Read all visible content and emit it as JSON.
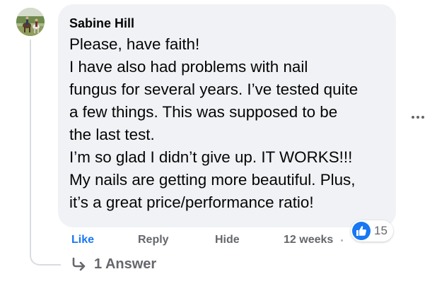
{
  "comment": {
    "author": "Sabine Hill",
    "lines": [
      "Please, have faith!",
      "I have also had problems with nail",
      "fungus for several years. I’ve tested quite",
      "a few things. This was supposed to be",
      "the last test.",
      "I’m so glad I didn’t give up. IT WORKS!!!",
      "My nails are getting more beautiful. Plus,",
      "it’s a great price/performance ratio!"
    ]
  },
  "actions": {
    "like": "Like",
    "reply": "Reply",
    "hide": "Hide",
    "time": "12 weeks"
  },
  "reactions": {
    "icon": "thumbs-up-icon",
    "count": "15"
  },
  "replies": {
    "icon": "reply-arrow-icon",
    "label": "1 Answer"
  },
  "icons": {
    "avatar": "avatar",
    "more": "more-options-icon"
  },
  "colors": {
    "bubble": "#f0f2f5",
    "like_blue": "#1877f2",
    "secondary_text": "#65676b"
  }
}
